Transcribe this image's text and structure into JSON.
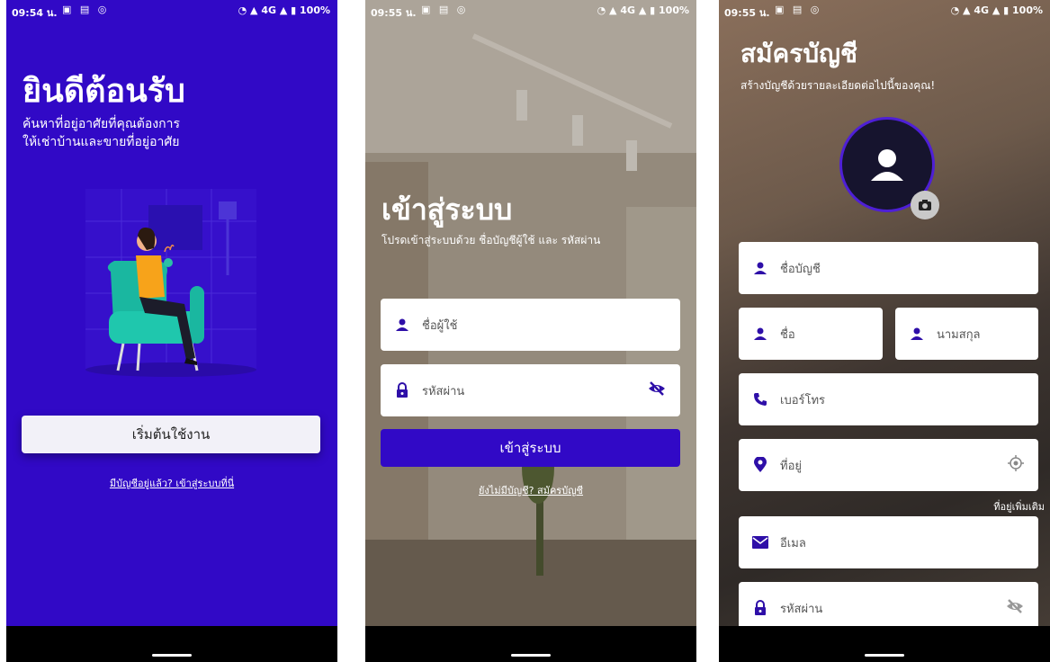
{
  "status": {
    "phone1_time": "09:54 น.",
    "phone2_time": "09:55 น.",
    "phone3_time": "09:55 น.",
    "battery": "100%",
    "network": "4G"
  },
  "welcome": {
    "title": "ยินดีต้อนรับ",
    "subtitle_line1": "ค้นหาที่อยู่อาศัยที่คุณต้องการ",
    "subtitle_line2": "ให้เช่าบ้านและขายที่อยู่อาศัย",
    "start_button": "เริ่มต้นใช้งาน",
    "login_link": "มีบัญชีอยู่แล้ว? เข้าสู่ระบบที่นี่"
  },
  "login": {
    "title": "เข้าสู่ระบบ",
    "subtitle": "โปรดเข้าสู่ระบบด้วย ชื่อบัญชีผู้ใช้ และ รหัสผ่าน",
    "username_placeholder": "ชื่อผู้ใช้",
    "password_placeholder": "รหัสผ่าน",
    "login_button": "เข้าสู่ระบบ",
    "register_link": "ยังไม่มีบัญชี? สมัครบัญชี"
  },
  "register": {
    "title": "สมัครบัญชี",
    "subtitle": "สร้างบัญชีด้วยรายละเอียดต่อไปนี้ของคุณ!",
    "account_placeholder": "ชื่อบัญชี",
    "first_name_placeholder": "ชื่อ",
    "last_name_placeholder": "นามสกุล",
    "phone_placeholder": "เบอร์โทร",
    "address_placeholder": "ที่อยู่",
    "more_address_link": "ที่อยู่เพิ่มเติม",
    "email_placeholder": "อีเมล",
    "password_placeholder": "รหัสผ่าน"
  },
  "colors": {
    "primary": "#3109c6",
    "icon": "#2e0fa8",
    "field_bg": "#ffffff"
  }
}
